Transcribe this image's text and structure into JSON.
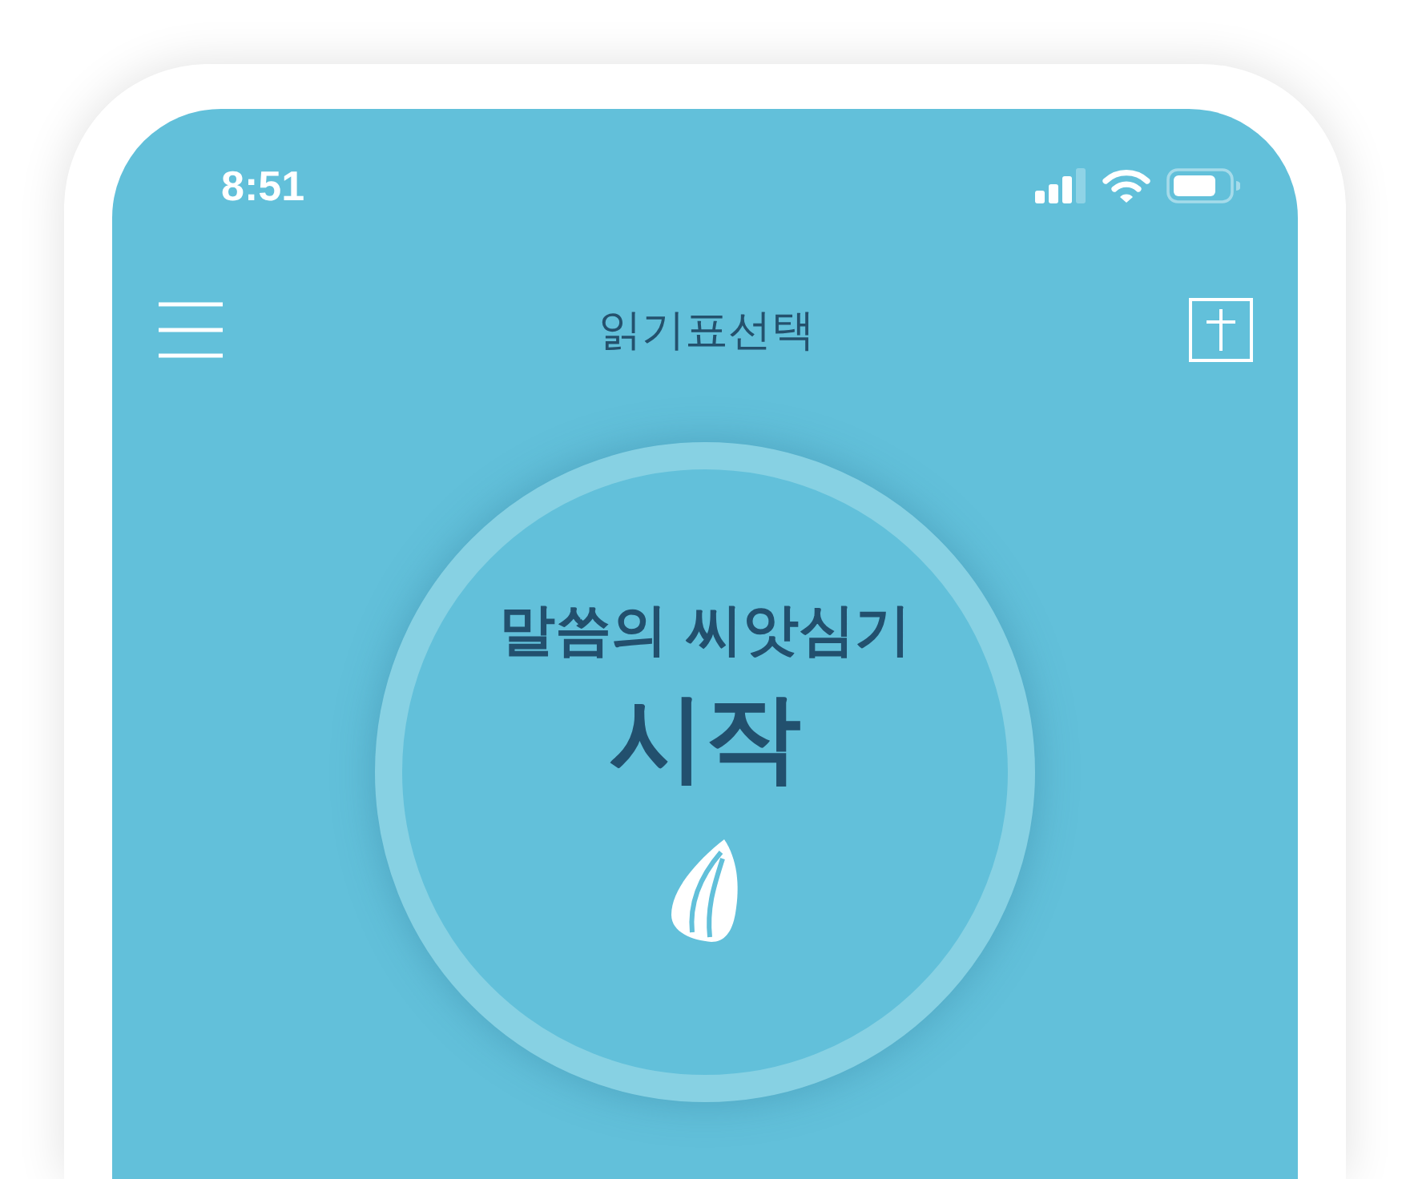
{
  "status_bar": {
    "time": "8:51"
  },
  "header": {
    "title": "읽기표선택"
  },
  "start_button": {
    "subtitle": "말씀의 씨앗심기",
    "label": "시작"
  }
}
